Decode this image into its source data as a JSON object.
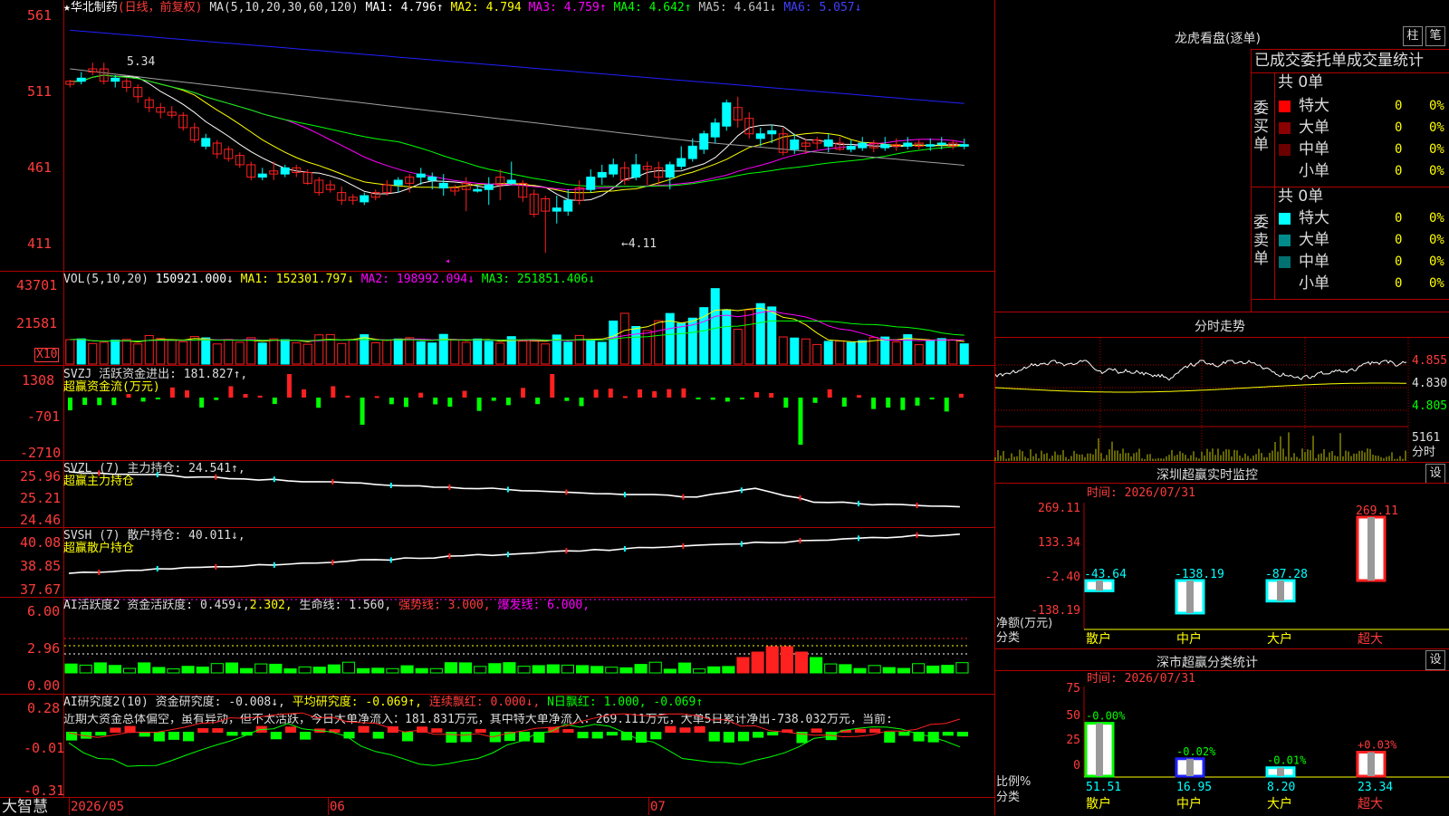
{
  "colors": {
    "up": "#ff2020",
    "down": "#00ffff",
    "ma1": "#ffffff",
    "ma2": "#ffff00",
    "ma3": "#ff00ff",
    "ma4": "#00ff00",
    "ma5": "#a0a0a0",
    "ma6": "#2020ff",
    "green": "#00ff00",
    "grid": "#b00000"
  },
  "main": {
    "star": "★",
    "stock_name": "华北制药",
    "period": "(日线，前复权)",
    "ma_params": "MA(5,10,20,30,60,120)",
    "ma1": "MA1: 4.796↑",
    "ma2": "MA2: 4.794",
    "ma3": "MA3: 4.759↑",
    "ma4": "MA4: 4.642↑",
    "ma5": "MA5: 4.641↓",
    "ma6": "MA6: 5.057↓",
    "y_labels": [
      "561",
      "511",
      "461",
      "411"
    ],
    "high_mark": "5.34",
    "low_mark": "←4.11"
  },
  "vol": {
    "title": "VOL(5,10,20)",
    "value": "150921.000↓",
    "ma1": "MA1: 152301.797↓",
    "ma2": "MA2: 198992.094↓",
    "ma3": "MA3: 251851.406↓",
    "y_labels": [
      "43701",
      "21581"
    ],
    "unit": "X10"
  },
  "svzj": {
    "title": "SVZJ  活跃资金进出: 181.827↑,",
    "sub": "超赢资金流(万元)",
    "y_labels": [
      "1308",
      "-701",
      "-2710"
    ]
  },
  "svzl": {
    "title": "SVZL (7) 主力持仓: 24.541↑,",
    "sub": "超赢主力持仓",
    "y_labels": [
      "25.96",
      "25.21",
      "24.46"
    ]
  },
  "svsh": {
    "title": "SVSH (7) 散户持仓: 40.011↓,",
    "sub": "超赢散户持仓",
    "y_labels": [
      "40.08",
      "38.85",
      "37.67"
    ]
  },
  "ai2": {
    "title": "AI活跃度2 资金活跃度: 0.459↓,",
    "v2": "2.302,",
    "life": "生命线: 1.560,",
    "strong": "强势线: 3.000,",
    "burst": "爆发线: 6.000,",
    "y_labels": [
      "6.00",
      "2.96",
      "0.00"
    ]
  },
  "ai_research": {
    "title": "AI研究度2(10) 资金研究度: -0.008↓,",
    "avg": "平均研究度: -0.069↑,",
    "cont": "连续飘红: 0.000↓,",
    "nday": "N日飘红: 1.000, -0.069↑",
    "summary": "近期大资金总体偏空，虽有异动，但不太活跃，今日大单净流入：181.831万元，其中特大单净流入：269.111万元，大单5日累计净出-738.032万元，当前:",
    "y_labels": [
      "0.28",
      "-0.01",
      "-0.31"
    ]
  },
  "bottom": {
    "brand": "大智慧",
    "dates": [
      "2026/05",
      "06",
      "07"
    ]
  },
  "lhb": {
    "title": "龙虎看盘(逐单)",
    "tab_zhu": "柱",
    "tab_bi": "笔",
    "header": "已成交委托单成交量统计",
    "buy": {
      "label": "委买单",
      "total": "共 0单",
      "rows": [
        {
          "name": "特大",
          "count": "0",
          "pct": "0%",
          "color": "#ff0000"
        },
        {
          "name": "大单",
          "count": "0",
          "pct": "0%",
          "color": "#8b0000"
        },
        {
          "name": "中单",
          "count": "0",
          "pct": "0%",
          "color": "#6b0000"
        },
        {
          "name": "小单",
          "count": "0",
          "pct": "0%",
          "color": "#000000"
        }
      ]
    },
    "sell": {
      "label": "委卖单",
      "total": "共 0单",
      "rows": [
        {
          "name": "特大",
          "count": "0",
          "pct": "0%",
          "color": "#00ffff"
        },
        {
          "name": "大单",
          "count": "0",
          "pct": "0%",
          "color": "#008b8b"
        },
        {
          "name": "中单",
          "count": "0",
          "pct": "0%",
          "color": "#007070"
        },
        {
          "name": "小单",
          "count": "0",
          "pct": "0%",
          "color": "#000000"
        }
      ]
    }
  },
  "fenshi": {
    "title": "分时走势",
    "prices": [
      "4.855",
      "4.830",
      "4.805"
    ],
    "vol": "5161",
    "vol_unit": "分时"
  },
  "monitor": {
    "title": "深圳超赢实时监控",
    "btn": "设",
    "time": "时间: 2026/07/31",
    "y_labels": [
      "269.11",
      "133.34",
      "-2.40",
      "-138.19"
    ],
    "bars": [
      {
        "cat": "散户",
        "value": -43.64,
        "label": "-43.64"
      },
      {
        "cat": "中户",
        "value": -138.19,
        "label": "-138.19"
      },
      {
        "cat": "大户",
        "value": -87.28,
        "label": "-87.28"
      },
      {
        "cat": "超大",
        "value": 269.11,
        "label": "269.11"
      }
    ],
    "ylabel": "净额(万元)",
    "xlabel": "分类"
  },
  "classify": {
    "title": "深市超赢分类统计",
    "btn": "设",
    "time": "时间: 2026/07/31",
    "y_labels": [
      "75",
      "50",
      "25",
      "0"
    ],
    "bars": [
      {
        "cat": "散户",
        "value": 51.51,
        "label": "51.51",
        "change": "-0.00%"
      },
      {
        "cat": "中户",
        "value": 16.95,
        "label": "16.95",
        "change": "-0.02%"
      },
      {
        "cat": "大户",
        "value": 8.2,
        "label": "8.20",
        "change": "-0.01%"
      },
      {
        "cat": "超大",
        "value": 23.34,
        "label": "23.34",
        "change": "+0.03%"
      }
    ],
    "ylabel": "比例%",
    "xlabel": "分类"
  },
  "chart_data": {
    "type": "candlestick",
    "title": "华北制药 (日线，前复权)",
    "ylim": [
      4.11,
      5.61
    ],
    "candles": [
      [
        5.2,
        5.22,
        5.23,
        5.18
      ],
      [
        5.24,
        5.22,
        5.28,
        5.2
      ],
      [
        5.28,
        5.3,
        5.34,
        5.26
      ],
      [
        5.22,
        5.3,
        5.34,
        5.2
      ],
      [
        5.24,
        5.22,
        5.26,
        5.18
      ],
      [
        5.18,
        5.22,
        5.24,
        5.15
      ],
      [
        5.12,
        5.18,
        5.2,
        5.08
      ],
      [
        5.05,
        5.1,
        5.12,
        5.02
      ],
      [
        5.02,
        5.05,
        5.08,
        4.98
      ],
      [
        5.0,
        5.02,
        5.06,
        4.98
      ],
      [
        4.92,
        5.0,
        5.02,
        4.9
      ],
      [
        4.84,
        4.92,
        4.95,
        4.82
      ],
      [
        4.85,
        4.8,
        4.88,
        4.78
      ],
      [
        4.75,
        4.82,
        4.84,
        4.72
      ],
      [
        4.72,
        4.78,
        4.8,
        4.7
      ],
      [
        4.68,
        4.74,
        4.76,
        4.66
      ],
      [
        4.6,
        4.68,
        4.7,
        4.58
      ],
      [
        4.62,
        4.6,
        4.66,
        4.58
      ],
      [
        4.62,
        4.64,
        4.7,
        4.58
      ],
      [
        4.66,
        4.62,
        4.68,
        4.6
      ],
      [
        4.63,
        4.66,
        4.68,
        4.6
      ],
      [
        4.56,
        4.63,
        4.65,
        4.55
      ],
      [
        4.5,
        4.58,
        4.6,
        4.48
      ],
      [
        4.52,
        4.55,
        4.58,
        4.5
      ],
      [
        4.45,
        4.5,
        4.54,
        4.42
      ],
      [
        4.45,
        4.47,
        4.49,
        4.42
      ],
      [
        4.48,
        4.44,
        4.5,
        4.42
      ],
      [
        4.47,
        4.5,
        4.52,
        4.45
      ],
      [
        4.5,
        4.55,
        4.58,
        4.48
      ],
      [
        4.58,
        4.55,
        4.6,
        4.5
      ],
      [
        4.56,
        4.6,
        4.62,
        4.5
      ],
      [
        4.62,
        4.6,
        4.66,
        4.55
      ],
      [
        4.6,
        4.58,
        4.63,
        4.52
      ],
      [
        4.56,
        4.53,
        4.62,
        4.48
      ],
      [
        4.51,
        4.53,
        4.55,
        4.48
      ],
      [
        4.52,
        4.56,
        4.6,
        4.38
      ],
      [
        4.52,
        4.51,
        4.55,
        4.5
      ],
      [
        4.55,
        4.52,
        4.6,
        4.42
      ],
      [
        4.55,
        4.6,
        4.65,
        4.45
      ],
      [
        4.58,
        4.56,
        4.7,
        4.55
      ],
      [
        4.47,
        4.56,
        4.58,
        4.44
      ],
      [
        4.36,
        4.49,
        4.52,
        4.34
      ],
      [
        4.38,
        4.46,
        4.48,
        4.11
      ],
      [
        4.4,
        4.38,
        4.48,
        4.3
      ],
      [
        4.45,
        4.38,
        4.52,
        4.35
      ],
      [
        4.45,
        4.53,
        4.58,
        4.42
      ],
      [
        4.6,
        4.52,
        4.65,
        4.5
      ],
      [
        4.63,
        4.6,
        4.68,
        4.55
      ],
      [
        4.68,
        4.62,
        4.72,
        4.6
      ],
      [
        4.58,
        4.66,
        4.7,
        4.55
      ],
      [
        4.68,
        4.6,
        4.75,
        4.58
      ],
      [
        4.65,
        4.67,
        4.7,
        4.55
      ],
      [
        4.6,
        4.66,
        4.7,
        4.55
      ],
      [
        4.68,
        4.6,
        4.7,
        4.52
      ],
      [
        4.72,
        4.67,
        4.8,
        4.65
      ],
      [
        4.8,
        4.72,
        4.85,
        4.7
      ],
      [
        4.88,
        4.78,
        4.9,
        4.75
      ],
      [
        4.95,
        4.86,
        4.98,
        4.82
      ],
      [
        5.08,
        4.93,
        5.1,
        4.9
      ],
      [
        4.97,
        5.05,
        5.12,
        4.92
      ],
      [
        4.88,
        4.98,
        5.02,
        4.85
      ],
      [
        4.88,
        4.85,
        4.92,
        4.8
      ],
      [
        4.9,
        4.88,
        4.94,
        4.82
      ],
      [
        4.76,
        4.88,
        4.92,
        4.74
      ],
      [
        4.84,
        4.78,
        4.88,
        4.75
      ],
      [
        4.8,
        4.82,
        4.85,
        4.75
      ],
      [
        4.82,
        4.84,
        4.86,
        4.78
      ],
      [
        4.84,
        4.8,
        4.88,
        4.76
      ],
      [
        4.78,
        4.82,
        4.86,
        4.77
      ],
      [
        4.8,
        4.78,
        4.84,
        4.76
      ],
      [
        4.82,
        4.79,
        4.86,
        4.77
      ],
      [
        4.79,
        4.82,
        4.84,
        4.76
      ],
      [
        4.81,
        4.79,
        4.86,
        4.77
      ],
      [
        4.8,
        4.81,
        4.85,
        4.77
      ],
      [
        4.82,
        4.8,
        4.86,
        4.78
      ],
      [
        4.8,
        4.82,
        4.84,
        4.78
      ],
      [
        4.81,
        4.8,
        4.85,
        4.77
      ],
      [
        4.82,
        4.81,
        4.86,
        4.78
      ],
      [
        4.8,
        4.82,
        4.84,
        4.78
      ],
      [
        4.81,
        4.8,
        4.85,
        4.78
      ]
    ],
    "ma_values": {
      "MA1": 4.796,
      "MA2": 4.794,
      "MA3": 4.759,
      "MA4": 4.642,
      "MA5": 4.641,
      "MA6": 5.057
    }
  }
}
